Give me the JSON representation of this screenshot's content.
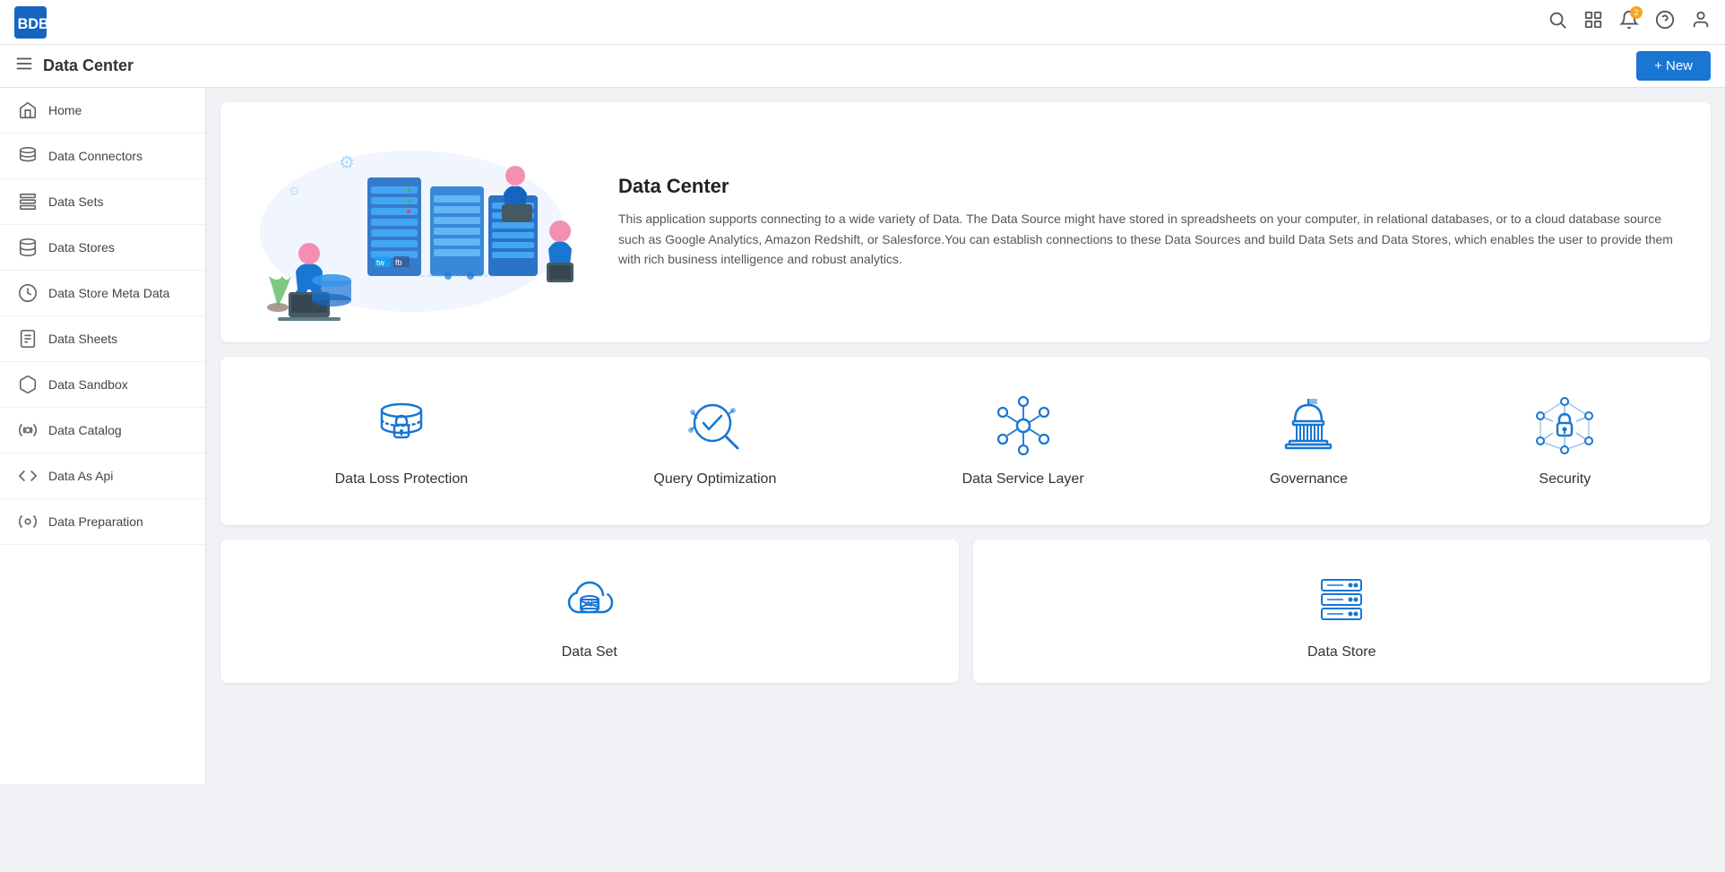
{
  "topbar": {
    "logo_text": "BDB",
    "icons": [
      "search-icon",
      "grid-icon",
      "notification-icon",
      "help-icon",
      "user-icon"
    ]
  },
  "subheader": {
    "title": "Data Center",
    "new_button": "+ New"
  },
  "sidebar": {
    "items": [
      {
        "id": "home",
        "label": "Home",
        "icon": "home-icon"
      },
      {
        "id": "data-connectors",
        "label": "Data Connectors",
        "icon": "data-connectors-icon"
      },
      {
        "id": "data-sets",
        "label": "Data Sets",
        "icon": "data-sets-icon"
      },
      {
        "id": "data-stores",
        "label": "Data Stores",
        "icon": "data-stores-icon"
      },
      {
        "id": "data-store-meta-data",
        "label": "Data Store Meta Data",
        "icon": "data-store-meta-icon"
      },
      {
        "id": "data-sheets",
        "label": "Data Sheets",
        "icon": "data-sheets-icon"
      },
      {
        "id": "data-sandbox",
        "label": "Data Sandbox",
        "icon": "data-sandbox-icon"
      },
      {
        "id": "data-catalog",
        "label": "Data Catalog",
        "icon": "data-catalog-icon"
      },
      {
        "id": "data-as-api",
        "label": "Data As Api",
        "icon": "data-as-api-icon"
      },
      {
        "id": "data-preparation",
        "label": "Data Preparation",
        "icon": "data-preparation-icon"
      }
    ]
  },
  "hero": {
    "title": "Data Center",
    "description": "This application supports connecting to a wide variety of Data. The Data Source might have stored in spreadsheets on your computer, in relational databases, or to a cloud database source such as Google Analytics, Amazon Redshift, or Salesforce.You can establish connections to these Data Sources and build Data Sets and Data Stores, which enables the user to provide them with rich business intelligence and robust analytics."
  },
  "features": [
    {
      "id": "data-loss-protection",
      "label": "Data Loss Protection"
    },
    {
      "id": "query-optimization",
      "label": "Query Optimization"
    },
    {
      "id": "data-service-layer",
      "label": "Data Service Layer"
    },
    {
      "id": "governance",
      "label": "Governance"
    },
    {
      "id": "security",
      "label": "Security"
    }
  ],
  "bottom_cards": [
    {
      "id": "data-set",
      "label": "Data Set"
    },
    {
      "id": "data-store",
      "label": "Data Store"
    }
  ]
}
